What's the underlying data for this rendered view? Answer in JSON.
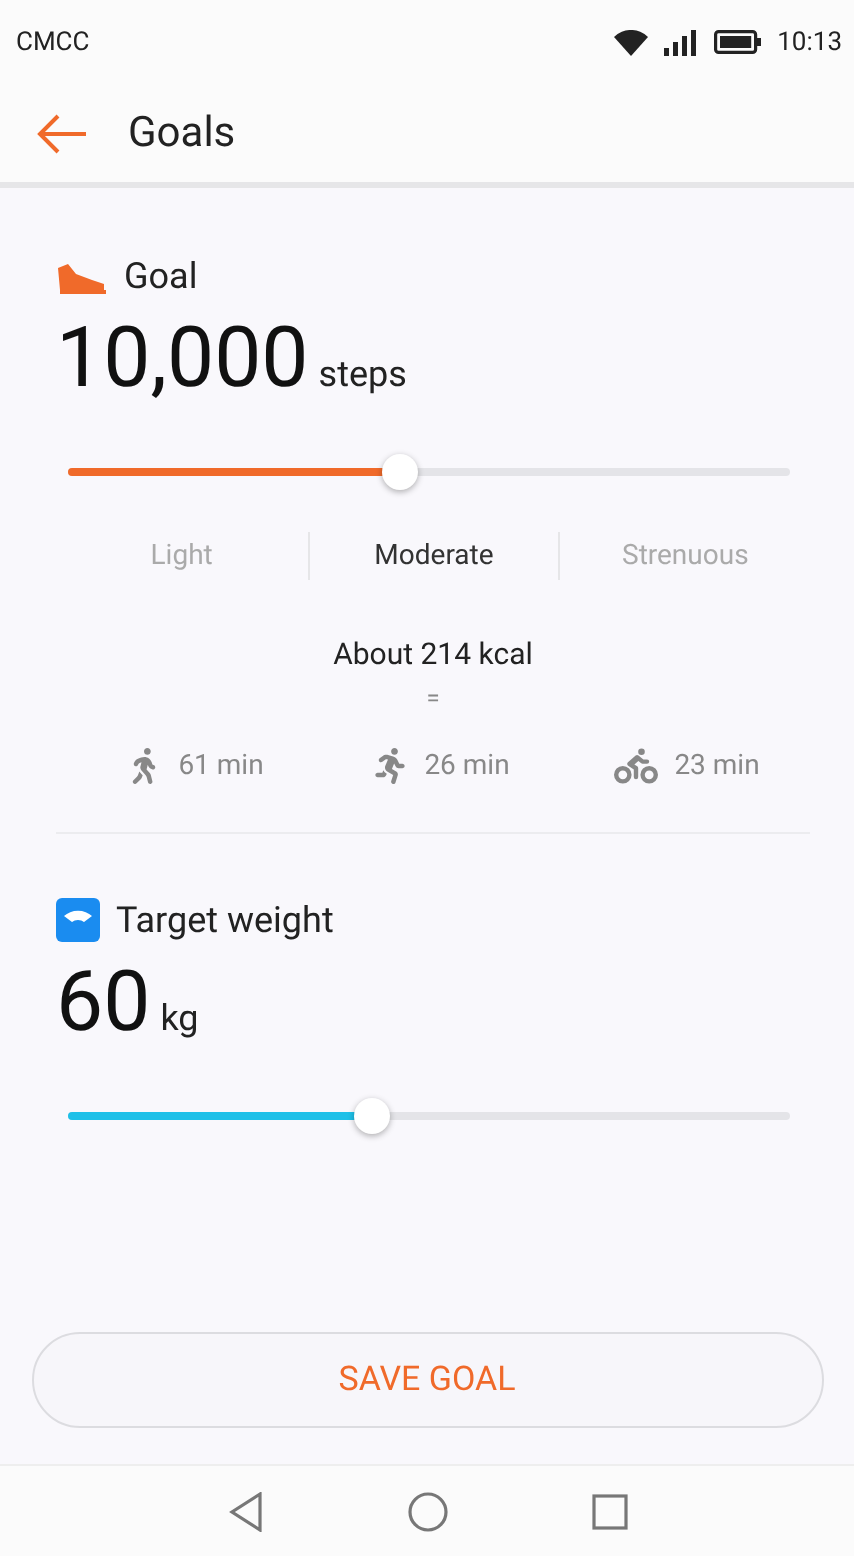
{
  "status_bar": {
    "carrier": "CMCC",
    "time": "10:13"
  },
  "header": {
    "title": "Goals"
  },
  "steps_goal": {
    "label": "Goal",
    "value": "10,000",
    "unit": "steps",
    "level": 0.46,
    "intensities": [
      {
        "label": "Light",
        "selected": false
      },
      {
        "label": "Moderate",
        "selected": true
      },
      {
        "label": "Strenuous",
        "selected": false
      }
    ],
    "energy": "About 214 kcal",
    "equals": "=",
    "activities": [
      {
        "kind": "walk",
        "duration": "61 min"
      },
      {
        "kind": "run",
        "duration": "26 min"
      },
      {
        "kind": "cycle",
        "duration": "23 min"
      }
    ]
  },
  "weight_goal": {
    "label": "Target weight",
    "value": "60",
    "unit": "kg",
    "level": 0.42
  },
  "save_button": "SAVE GOAL"
}
